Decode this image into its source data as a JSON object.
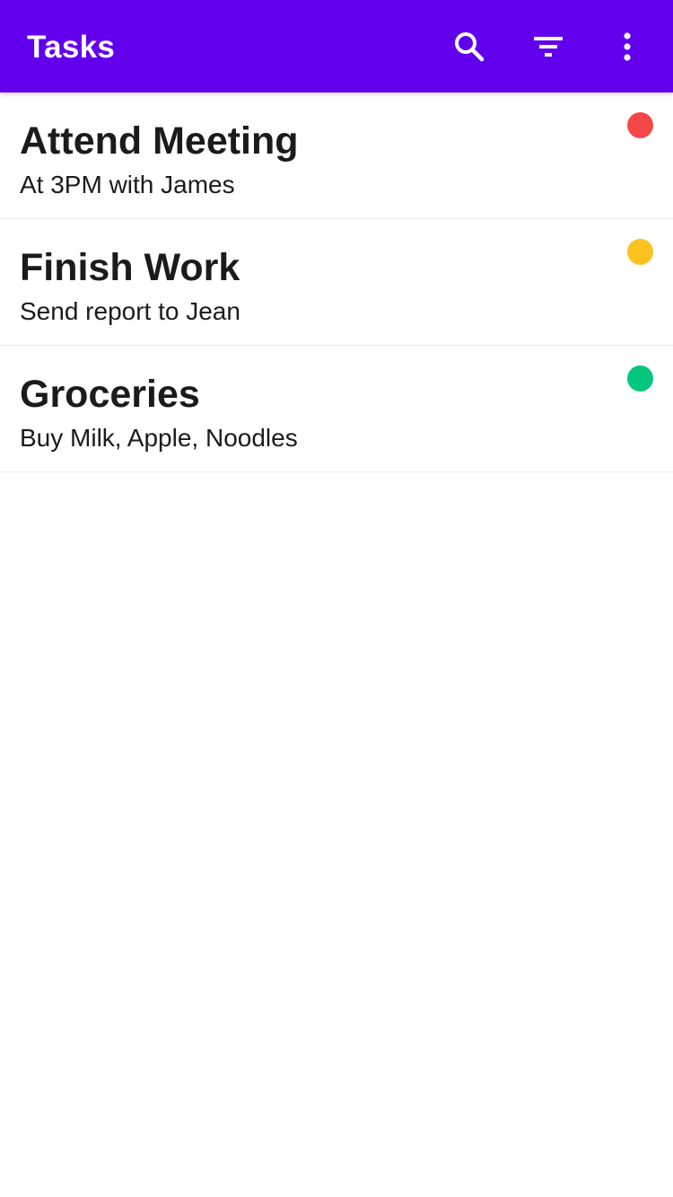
{
  "app_bar": {
    "title": "Tasks",
    "background": "#6200EE",
    "actions": [
      {
        "icon": "search-icon"
      },
      {
        "icon": "filter-icon"
      },
      {
        "icon": "more-vert-icon"
      }
    ]
  },
  "tasks": [
    {
      "title": "Attend Meeting",
      "description": "At 3PM with James",
      "priority_color": "#F44848"
    },
    {
      "title": "Finish Work",
      "description": "Send report to Jean",
      "priority_color": "#FBC11E"
    },
    {
      "title": "Groceries",
      "description": "Buy Milk, Apple, Noodles",
      "priority_color": "#04C77D"
    }
  ]
}
